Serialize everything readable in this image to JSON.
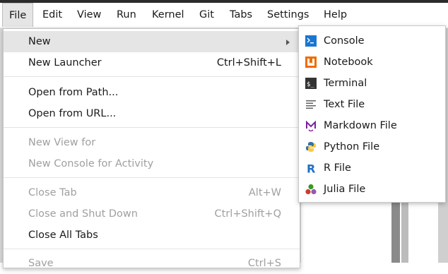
{
  "menubar": {
    "items": [
      "File",
      "Edit",
      "View",
      "Run",
      "Kernel",
      "Git",
      "Tabs",
      "Settings",
      "Help"
    ],
    "active": "File"
  },
  "file_menu": {
    "new": "New",
    "new_launcher": "New Launcher",
    "new_launcher_shortcut": "Ctrl+Shift+L",
    "open_from_path": "Open from Path...",
    "open_from_url": "Open from URL...",
    "new_view_for": "New View for",
    "new_console_for_activity": "New Console for Activity",
    "close_tab": "Close Tab",
    "close_tab_shortcut": "Alt+W",
    "close_and_shut_down": "Close and Shut Down",
    "close_and_shut_down_shortcut": "Ctrl+Shift+Q",
    "close_all_tabs": "Close All Tabs",
    "save": "Save",
    "save_shortcut": "Ctrl+S"
  },
  "new_submenu": {
    "items": [
      {
        "label": "Console",
        "icon": "console-icon"
      },
      {
        "label": "Notebook",
        "icon": "notebook-icon"
      },
      {
        "label": "Terminal",
        "icon": "terminal-icon"
      },
      {
        "label": "Text File",
        "icon": "text-file-icon"
      },
      {
        "label": "Markdown File",
        "icon": "markdown-icon"
      },
      {
        "label": "Python File",
        "icon": "python-icon"
      },
      {
        "label": "R File",
        "icon": "r-icon"
      },
      {
        "label": "Julia File",
        "icon": "julia-icon"
      }
    ]
  },
  "colors": {
    "highlight": "#e5e5e5",
    "console": "#1976d2",
    "notebook": "#ef6c00",
    "terminal": "#333333",
    "markdown": "#7b1fa2",
    "python_blue": "#3572a5",
    "python_yellow": "#f7c948",
    "r": "#1f6fc6",
    "julia_red": "#cb3c33",
    "julia_green": "#389826",
    "julia_purple": "#9558b2"
  }
}
